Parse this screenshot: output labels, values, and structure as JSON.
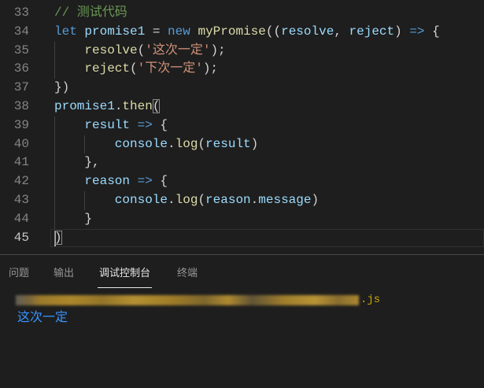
{
  "theme": {
    "background": "#1e1e1e",
    "active_tab": "#e7e7e7",
    "inactive_tab": "#969696",
    "console_path": "#cca700",
    "console_output": "#3794ff"
  },
  "token_colors": {
    "comment": "#6a9955",
    "keyword": "#569cd6",
    "variable": "#9cdcfe",
    "function": "#dcdcaa",
    "string": "#ce9178",
    "punct": "#d4d4d4"
  },
  "editor": {
    "lines": [
      {
        "number": 33,
        "indent": 0,
        "tokens": [
          {
            "text": "// 测试代码",
            "type": "comment"
          }
        ]
      },
      {
        "number": 34,
        "indent": 0,
        "tokens": [
          {
            "text": "let",
            "type": "keyword"
          },
          {
            "text": " ",
            "type": "punct"
          },
          {
            "text": "promise1",
            "type": "variable"
          },
          {
            "text": " = ",
            "type": "punct"
          },
          {
            "text": "new",
            "type": "keyword"
          },
          {
            "text": " ",
            "type": "punct"
          },
          {
            "text": "myPromise",
            "type": "function"
          },
          {
            "text": "((",
            "type": "punct"
          },
          {
            "text": "resolve",
            "type": "variable"
          },
          {
            "text": ", ",
            "type": "punct"
          },
          {
            "text": "reject",
            "type": "variable"
          },
          {
            "text": ") ",
            "type": "punct"
          },
          {
            "text": "=>",
            "type": "keyword"
          },
          {
            "text": " {",
            "type": "punct"
          }
        ]
      },
      {
        "number": 35,
        "indent": 1,
        "tokens": [
          {
            "text": "resolve",
            "type": "function"
          },
          {
            "text": "(",
            "type": "punct"
          },
          {
            "text": "'这次一定'",
            "type": "string"
          },
          {
            "text": ");",
            "type": "punct"
          }
        ]
      },
      {
        "number": 36,
        "indent": 1,
        "tokens": [
          {
            "text": "reject",
            "type": "function"
          },
          {
            "text": "(",
            "type": "punct"
          },
          {
            "text": "'下次一定'",
            "type": "string"
          },
          {
            "text": ");",
            "type": "punct"
          }
        ]
      },
      {
        "number": 37,
        "indent": 0,
        "tokens": [
          {
            "text": "})",
            "type": "punct"
          }
        ]
      },
      {
        "number": 38,
        "indent": 0,
        "tokens": [
          {
            "text": "promise1",
            "type": "variable"
          },
          {
            "text": ".",
            "type": "punct"
          },
          {
            "text": "then",
            "type": "function"
          },
          {
            "text": "(",
            "type": "punct",
            "match": true
          }
        ]
      },
      {
        "number": 39,
        "indent": 1,
        "tokens": [
          {
            "text": "result",
            "type": "variable"
          },
          {
            "text": " ",
            "type": "punct"
          },
          {
            "text": "=>",
            "type": "keyword"
          },
          {
            "text": " {",
            "type": "punct"
          }
        ]
      },
      {
        "number": 40,
        "indent": 2,
        "tokens": [
          {
            "text": "console",
            "type": "variable"
          },
          {
            "text": ".",
            "type": "punct"
          },
          {
            "text": "log",
            "type": "function"
          },
          {
            "text": "(",
            "type": "punct"
          },
          {
            "text": "result",
            "type": "variable"
          },
          {
            "text": ")",
            "type": "punct"
          }
        ]
      },
      {
        "number": 41,
        "indent": 1,
        "tokens": [
          {
            "text": "},",
            "type": "punct"
          }
        ]
      },
      {
        "number": 42,
        "indent": 1,
        "tokens": [
          {
            "text": "reason",
            "type": "variable"
          },
          {
            "text": " ",
            "type": "punct"
          },
          {
            "text": "=>",
            "type": "keyword"
          },
          {
            "text": " {",
            "type": "punct"
          }
        ]
      },
      {
        "number": 43,
        "indent": 2,
        "tokens": [
          {
            "text": "console",
            "type": "variable"
          },
          {
            "text": ".",
            "type": "punct"
          },
          {
            "text": "log",
            "type": "function"
          },
          {
            "text": "(",
            "type": "punct"
          },
          {
            "text": "reason",
            "type": "variable"
          },
          {
            "text": ".",
            "type": "punct"
          },
          {
            "text": "message",
            "type": "variable"
          },
          {
            "text": ")",
            "type": "punct"
          }
        ]
      },
      {
        "number": 44,
        "indent": 1,
        "tokens": [
          {
            "text": "}",
            "type": "punct"
          }
        ]
      },
      {
        "number": 45,
        "indent": 0,
        "active": true,
        "tokens": [
          {
            "text": ")",
            "type": "punct",
            "match": true
          }
        ]
      }
    ]
  },
  "panel": {
    "tabs": [
      {
        "label": "问题",
        "active": false
      },
      {
        "label": "输出",
        "active": false
      },
      {
        "label": "调试控制台",
        "active": true
      },
      {
        "label": "终端",
        "active": false
      }
    ],
    "console": {
      "path_suffix": ".js",
      "output": "这次一定"
    }
  }
}
